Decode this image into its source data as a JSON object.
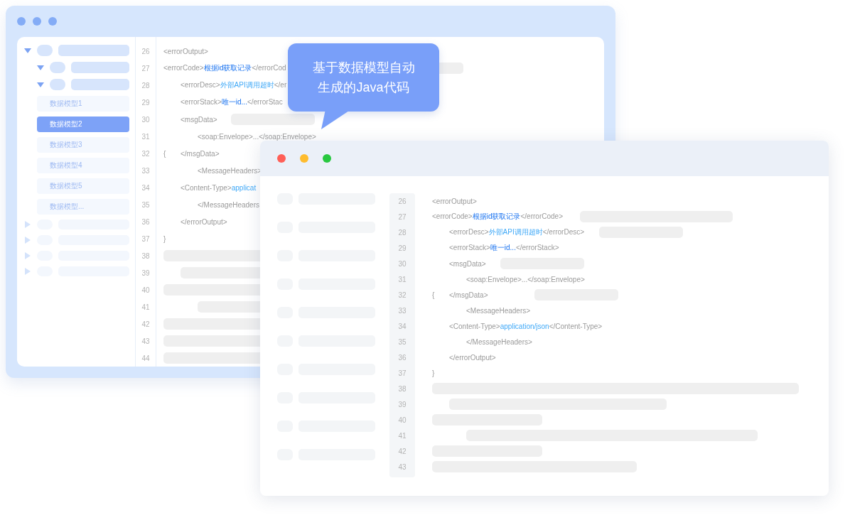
{
  "back_window": {
    "sidebar": {
      "items": [
        {
          "label": "数据模型1",
          "selected": false
        },
        {
          "label": "数据模型2",
          "selected": true
        },
        {
          "label": "数据模型3",
          "selected": false
        },
        {
          "label": "数据模型4",
          "selected": false
        },
        {
          "label": "数据模型5",
          "selected": false
        },
        {
          "label": "数据模型...",
          "selected": false
        }
      ]
    },
    "code_lines": [
      {
        "number": "26",
        "segments": [
          {
            "kind": "tag",
            "text": "<errorOutput>"
          }
        ]
      },
      {
        "number": "27",
        "segments": [
          {
            "kind": "tag",
            "text": "<errorCode>"
          },
          {
            "kind": "strong",
            "text": "根据id获取记录"
          },
          {
            "kind": "tag",
            "text": "</errorCod"
          }
        ]
      },
      {
        "number": "28",
        "segments": [
          {
            "kind": "tag",
            "text": "<errorDesc>"
          },
          {
            "kind": "value",
            "text": "外部API调用超时"
          },
          {
            "kind": "tag",
            "text": "</er"
          }
        ]
      },
      {
        "number": "29",
        "segments": [
          {
            "kind": "tag",
            "text": "<errorStack>"
          },
          {
            "kind": "strong",
            "text": "唯一id..."
          },
          {
            "kind": "tag",
            "text": "</errorStac"
          }
        ]
      },
      {
        "number": "30",
        "segments": [
          {
            "kind": "tag",
            "text": "<msgData>"
          }
        ]
      },
      {
        "number": "31",
        "segments": [
          {
            "kind": "tag",
            "text": "<soap:Envelope>...</soap:Envelope>"
          }
        ]
      },
      {
        "number": "32",
        "prefix": "{",
        "segments": [
          {
            "kind": "tag",
            "text": "</msgData>"
          }
        ]
      },
      {
        "number": "33",
        "segments": [
          {
            "kind": "tag",
            "text": "<MessageHeaders>"
          }
        ]
      },
      {
        "number": "34",
        "segments": [
          {
            "kind": "tag",
            "text": "<Content-Type>"
          },
          {
            "kind": "value",
            "text": "applicat"
          }
        ]
      },
      {
        "number": "35",
        "segments": [
          {
            "kind": "tag",
            "text": "</MessageHeaders"
          }
        ]
      },
      {
        "number": "36",
        "segments": [
          {
            "kind": "tag",
            "text": "</errorOutput>"
          }
        ]
      },
      {
        "number": "37",
        "segments": [
          {
            "kind": "tag",
            "text": "}"
          }
        ]
      },
      {
        "number": "38"
      },
      {
        "number": "39"
      },
      {
        "number": "40"
      },
      {
        "number": "41"
      },
      {
        "number": "42"
      },
      {
        "number": "43"
      },
      {
        "number": "44"
      }
    ]
  },
  "bubble": {
    "text": "基于数据模型自动生成的Java代码"
  },
  "front_window": {
    "code_lines": [
      {
        "number": "26",
        "segments": [
          {
            "kind": "tag",
            "text": "<errorOutput>"
          }
        ]
      },
      {
        "number": "27",
        "segments": [
          {
            "kind": "tag",
            "text": "<errorCode>"
          },
          {
            "kind": "strong",
            "text": "根据id获取记录"
          },
          {
            "kind": "tag",
            "text": "</errorCode>"
          }
        ]
      },
      {
        "number": "28",
        "segments": [
          {
            "kind": "tag",
            "text": "<errorDesc>"
          },
          {
            "kind": "value",
            "text": "外部API调用超时"
          },
          {
            "kind": "tag",
            "text": "</errorDesc>"
          }
        ]
      },
      {
        "number": "29",
        "segments": [
          {
            "kind": "tag",
            "text": "<errorStack>"
          },
          {
            "kind": "strong",
            "text": "唯一id..."
          },
          {
            "kind": "tag",
            "text": "</errorStack>"
          }
        ]
      },
      {
        "number": "30",
        "segments": [
          {
            "kind": "tag",
            "text": "<msgData>"
          }
        ]
      },
      {
        "number": "31",
        "segments": [
          {
            "kind": "tag",
            "text": "<soap:Envelope>...</soap:Envelope>"
          }
        ]
      },
      {
        "number": "32",
        "prefix": "{",
        "segments": [
          {
            "kind": "tag",
            "text": "</msgData>"
          }
        ]
      },
      {
        "number": "33",
        "segments": [
          {
            "kind": "tag",
            "text": "<MessageHeaders>"
          }
        ]
      },
      {
        "number": "34",
        "segments": [
          {
            "kind": "tag",
            "text": "<Content-Type>"
          },
          {
            "kind": "value",
            "text": "application/json"
          },
          {
            "kind": "tag",
            "text": "</Content-Type>"
          }
        ]
      },
      {
        "number": "35",
        "segments": [
          {
            "kind": "tag",
            "text": "</MessageHeaders>"
          }
        ]
      },
      {
        "number": "36",
        "segments": [
          {
            "kind": "tag",
            "text": "</errorOutput>"
          }
        ]
      },
      {
        "number": "37",
        "segments": [
          {
            "kind": "tag",
            "text": "}"
          }
        ]
      },
      {
        "number": "38"
      },
      {
        "number": "39"
      },
      {
        "number": "40"
      },
      {
        "number": "41"
      },
      {
        "number": "42"
      },
      {
        "number": "43"
      }
    ]
  }
}
